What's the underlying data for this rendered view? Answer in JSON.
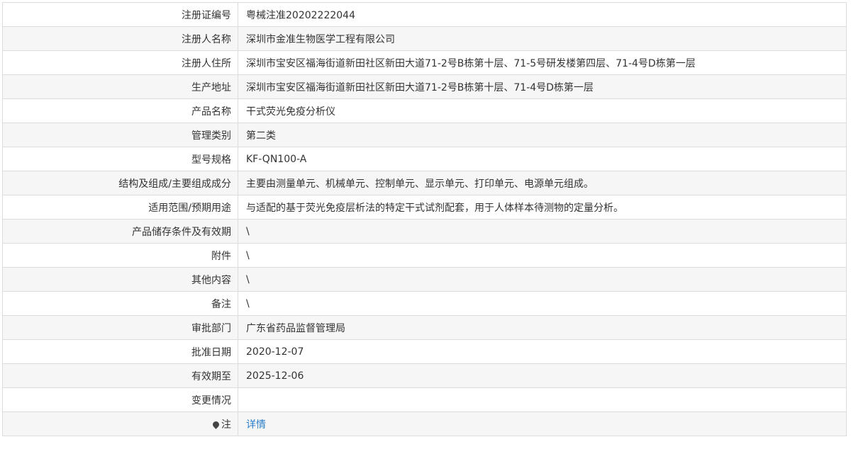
{
  "rows": [
    {
      "label": "注册证编号",
      "value": "粤械注准20202222044"
    },
    {
      "label": "注册人名称",
      "value": "深圳市金准生物医学工程有限公司"
    },
    {
      "label": "注册人住所",
      "value": "深圳市宝安区福海街道新田社区新田大道71-2号B栋第十层、71-5号研发楼第四层、71-4号D栋第一层"
    },
    {
      "label": "生产地址",
      "value": "深圳市宝安区福海街道新田社区新田大道71-2号B栋第十层、71-4号D栋第一层"
    },
    {
      "label": "产品名称",
      "value": "干式荧光免疫分析仪"
    },
    {
      "label": "管理类别",
      "value": "第二类"
    },
    {
      "label": "型号规格",
      "value": "KF-QN100-A"
    },
    {
      "label": "结构及组成/主要组成成分",
      "value": "主要由测量单元、机械单元、控制单元、显示单元、打印单元、电源单元组成。"
    },
    {
      "label": "适用范围/预期用途",
      "value": "与适配的基于荧光免疫层析法的特定干式试剂配套，用于人体样本待测物的定量分析。"
    },
    {
      "label": "产品储存条件及有效期",
      "value": "\\"
    },
    {
      "label": "附件",
      "value": "\\"
    },
    {
      "label": "其他内容",
      "value": "\\"
    },
    {
      "label": "备注",
      "value": "\\"
    },
    {
      "label": "审批部门",
      "value": "广东省药品监督管理局"
    },
    {
      "label": "批准日期",
      "value": "2020-12-07"
    },
    {
      "label": "有效期至",
      "value": "2025-12-06"
    },
    {
      "label": "变更情况",
      "value": ""
    }
  ],
  "note_row": {
    "label": "注",
    "link_text": "详情",
    "icon": "map-pin-icon"
  },
  "colors": {
    "link": "#2a7ec8",
    "border": "#dcdcdc",
    "row_alt": "#f6f6f6"
  }
}
